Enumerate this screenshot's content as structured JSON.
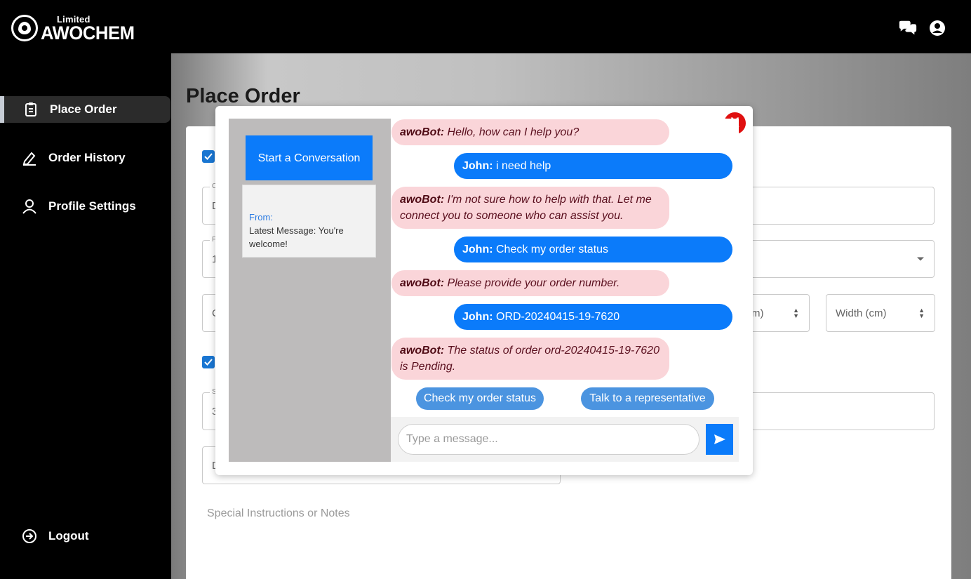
{
  "app": {
    "logo_small": "Limited",
    "logo_big": "AWOCHEM"
  },
  "header_icons": [
    "chat-bubbles-icon",
    "user-circle-icon"
  ],
  "sidebar": {
    "items": [
      {
        "label": "Place Order",
        "icon": "clipboard-icon",
        "active": true
      },
      {
        "label": "Order History",
        "icon": "pencil-icon",
        "active": false
      },
      {
        "label": "Profile Settings",
        "icon": "user-icon",
        "active": false
      }
    ],
    "logout": {
      "label": "Logout",
      "icon": "logout-icon"
    }
  },
  "page": {
    "title": "Place Order"
  },
  "form": {
    "field1_label": "C",
    "field1_value": "D",
    "field2_label": "F",
    "field2_value": "1",
    "field3_value": "C",
    "length_partial": "m)",
    "width_placeholder": "Width (cm)",
    "field4_label": "S",
    "field4_value": "3",
    "field5_value": "D",
    "notes_placeholder": "Special Instructions or Notes"
  },
  "chat": {
    "close_label": "X",
    "start_button": "Start a Conversation",
    "conversation": {
      "from_label": "From:",
      "latest": "Latest Message: You're welcome!"
    },
    "messages": [
      {
        "sender": "awoBot:",
        "text": " Hello, how can I help you?",
        "type": "bot"
      },
      {
        "sender": "John:",
        "text": " i need help",
        "type": "user"
      },
      {
        "sender": "awoBot:",
        "text": " I'm not sure how to help with that. Let me connect you to someone who can assist you.",
        "type": "bot"
      },
      {
        "sender": "John:",
        "text": " Check my order status",
        "type": "user"
      },
      {
        "sender": "awoBot:",
        "text": " Please provide your order number.",
        "type": "bot"
      },
      {
        "sender": "John:",
        "text": " ORD-20240415-19-7620",
        "type": "user"
      },
      {
        "sender": "awoBot:",
        "text": " The status of order ord-20240415-19-7620 is Pending.",
        "type": "bot"
      }
    ],
    "quick_replies": [
      "Check my order status",
      "Talk to a representative"
    ],
    "input_placeholder": "Type a message...",
    "colors": {
      "bot_bubble": "#fad5d9",
      "user_bubble": "#0b7bfa",
      "close": "#e01010"
    }
  }
}
